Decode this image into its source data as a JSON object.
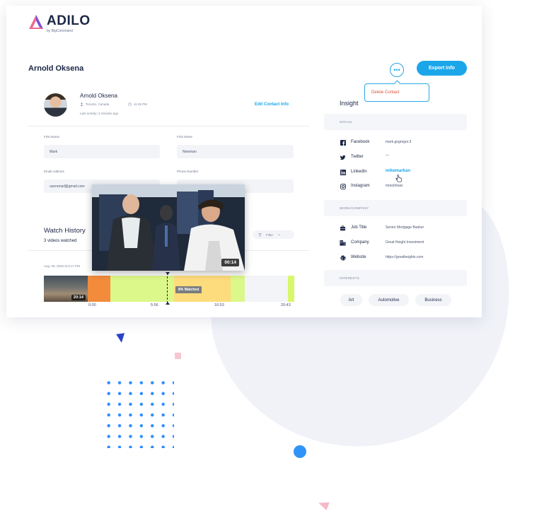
{
  "brand": {
    "name": "ADILO",
    "sub": "by BigCommand"
  },
  "contact": {
    "title": "Arnold Oksena"
  },
  "header": {
    "export_label": "Export Info",
    "more_label": "•••",
    "menu": {
      "delete_label": "Delete Contact"
    }
  },
  "profile": {
    "name": "Arnold Oksena",
    "location": "Toronto, Canada",
    "time": "11:45 PM",
    "last_activity": "Last activity: 2 minutes ago",
    "edit_label": "Edit Contact Info"
  },
  "form": {
    "first_name_label": "First Name",
    "first_name_value": "Mark",
    "last_name_label": "First Name",
    "last_name_value": "Newman",
    "email_label": "Email Address",
    "email_value": "useremail@gmail.com",
    "phone_label": "Phone Number",
    "phone_value": ""
  },
  "watch_history": {
    "title": "Watch History",
    "subtitle": "3 videos watched",
    "filter_label": "Filter",
    "date": "Aug. 09, 2020 at 6:17 PM",
    "thumb_duration": "20:14",
    "popup_duration": "00:14",
    "watched_label": "8% Watched",
    "ticks": [
      "0:00",
      "5:56",
      "16:53",
      "20:43"
    ],
    "colors": {
      "orange": "#f28b3c",
      "lime": "#dcf78a",
      "yellow": "#fcdc7c",
      "bright_lime": "#d8f76a"
    }
  },
  "insight": {
    "title": "Insight",
    "social_header": "SOCIAL",
    "social": [
      {
        "icon": "facebook-icon",
        "label": "Facebook",
        "value": "mark.gogregor.3"
      },
      {
        "icon": "twitter-icon",
        "label": "Twitter",
        "value": "—"
      },
      {
        "icon": "linkedin-icon",
        "label": "LinkedIn",
        "value": "mikemarkan"
      },
      {
        "icon": "instagram-icon",
        "label": "Instagram",
        "value": "mrko0maiv"
      }
    ],
    "work_header": "WORK/COMPANY",
    "work": [
      {
        "icon": "briefcase-icon",
        "label": "Job Title",
        "value": "Senior Mortgage Banker"
      },
      {
        "icon": "building-icon",
        "label": "Company",
        "value": "Great Height Investment"
      },
      {
        "icon": "globe-icon",
        "label": "Website",
        "value": "https://greatheights.com"
      }
    ],
    "interests_header": "INTERESTS",
    "interests": [
      "Art",
      "Automotive",
      "Business"
    ]
  },
  "accent_color": "#1ba6ea"
}
